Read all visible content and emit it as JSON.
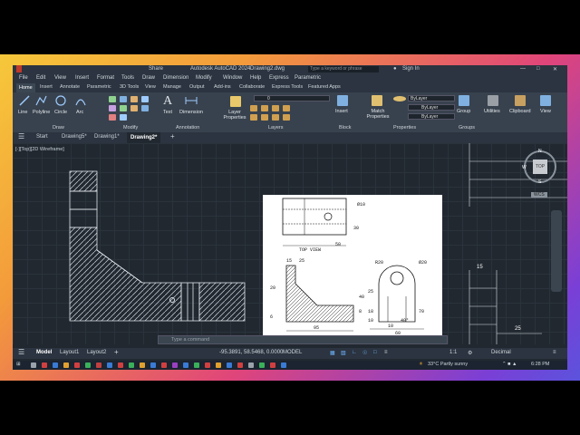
{
  "title": {
    "share": "Share",
    "app": "Autodesk AutoCAD 2024",
    "file": "Drawing2.dwg",
    "search_placeholder": "Type a keyword or phrase",
    "sign_in": "Sign In"
  },
  "menu": [
    "File",
    "Edit",
    "View",
    "Insert",
    "Format",
    "Tools",
    "Draw",
    "Dimension",
    "Modify",
    "Window",
    "Help",
    "Express",
    "Parametric"
  ],
  "ribbon_tabs": [
    "Home",
    "Insert",
    "Annotate",
    "Parametric",
    "3D Tools",
    "View",
    "Manage",
    "Output",
    "Add-ins",
    "Collaborate",
    "Express Tools",
    "Featured Apps"
  ],
  "ribbon": {
    "draw_tools": [
      "Line",
      "Polyline",
      "Circle",
      "Arc"
    ],
    "annot_tools": [
      "Text",
      "Dimension"
    ],
    "layer_props": "Layer Properties",
    "layer_value": "0",
    "insert": "Insert",
    "match_props": "Match Properties",
    "bylayer": "ByLayer",
    "group": "Group",
    "utilities": "Utilities",
    "clipboard": "Clipboard",
    "view": "View",
    "panels": [
      "Draw",
      "Modify",
      "Annotation",
      "Layers",
      "Block",
      "Properties",
      "Groups"
    ]
  },
  "doc_tabs": [
    "Start",
    "Drawing5*",
    "Drawing1*",
    "Drawing2*"
  ],
  "viewport_label": "[-][Top][2D Wireframe]",
  "command_placeholder": "Type a command",
  "sheet": {
    "top_view": "TOP VIEW",
    "front_section": "FRONT SECTIONAL VIEW",
    "right_view": "RIGHT SIDE VIEW",
    "dims": [
      "Ø10",
      "30",
      "50",
      "15",
      "25",
      "R20",
      "Ø20",
      "20",
      "6",
      "40",
      "25",
      "8",
      "18",
      "10",
      "95",
      "70",
      "60",
      "40°",
      "10"
    ]
  },
  "right_dims": [
    "15",
    "25"
  ],
  "viewcube_label": "TOP",
  "viewcube_compass": [
    "N",
    "W",
    "S"
  ],
  "wcs": "WCS",
  "status": {
    "model": "Model",
    "layouts": [
      "Layout1",
      "Layout2"
    ],
    "coords": "-95.3891, 58.5468, 0.0000",
    "mode": "MODEL",
    "scale": "1:1",
    "units": "Decimal"
  },
  "taskbar": {
    "weather": "33°C  Partly sunny",
    "time": "6:28 PM"
  }
}
